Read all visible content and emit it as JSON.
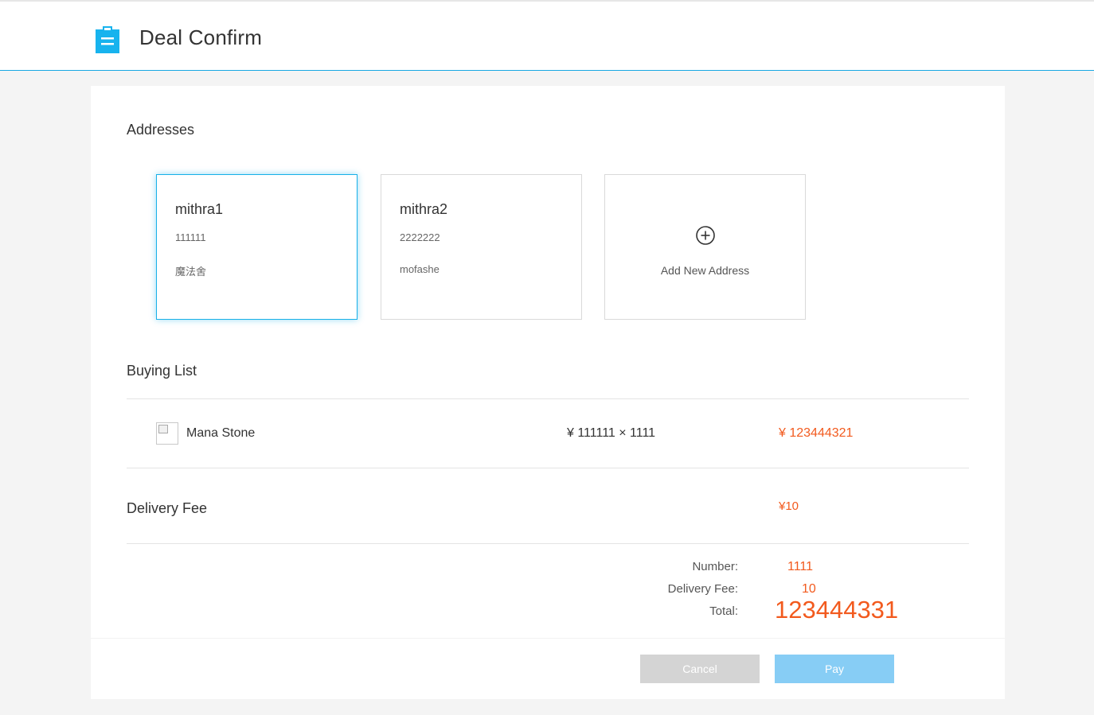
{
  "header": {
    "title": "Deal Confirm",
    "icon": "clipboard-icon",
    "accent_color": "#17a8e3"
  },
  "addresses": {
    "title": "Addresses",
    "items": [
      {
        "name": "mithra1",
        "phone": "111111",
        "address": "魔法舍",
        "selected": true
      },
      {
        "name": "mithra2",
        "phone": "2222222",
        "address": "mofashe",
        "selected": false
      }
    ],
    "add_label": "Add New Address",
    "add_icon": "plus-circle-icon"
  },
  "buying_list": {
    "title": "Buying List",
    "items": [
      {
        "name": "Mana Stone",
        "unit_price": "¥ 111111 × 1111",
        "subtotal": "¥ 123444321"
      }
    ]
  },
  "delivery": {
    "label": "Delivery Fee",
    "value": "¥10"
  },
  "summary": {
    "number_label": "Number:",
    "number_value": "1111",
    "fee_label": "Delivery Fee:",
    "fee_value": "10",
    "total_label": "Total:",
    "total_value": "123444331"
  },
  "actions": {
    "cancel_label": "Cancel",
    "pay_label": "Pay"
  },
  "colors": {
    "price": "#f25a1e",
    "selected_border": "#17b0e8",
    "pay_button": "#87cdf5",
    "cancel_button": "#d4d4d4"
  }
}
